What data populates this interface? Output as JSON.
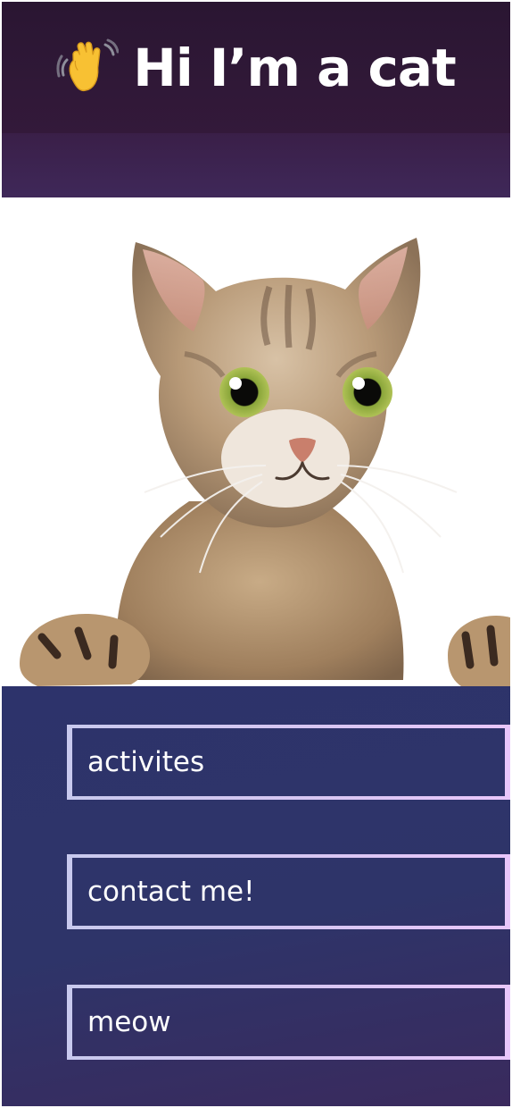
{
  "header": {
    "title": "Hi I’m a cat",
    "icon": "waving-hand-icon"
  },
  "hero": {
    "image": "cat-photo"
  },
  "menu": {
    "items": [
      {
        "label": "activites"
      },
      {
        "label": "contact me!"
      },
      {
        "label": "meow"
      }
    ]
  },
  "colors": {
    "header_bg": "#2a1632",
    "subband_bg": "#3f2859",
    "menu_bg": "#2d336b",
    "button_border_start": "#c8c9ee",
    "button_border_end": "#e9c6fb",
    "text": "#ffffff"
  }
}
